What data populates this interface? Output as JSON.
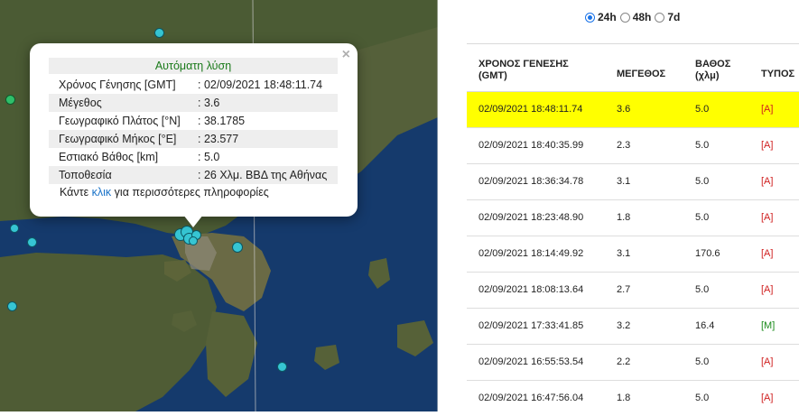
{
  "popup": {
    "title": "Αυτόματη λύση",
    "close_symbol": "×",
    "rows": [
      {
        "label": "Χρόνος Γένησης [GMT]",
        "value": ": 02/09/2021 18:48:11.74"
      },
      {
        "label": "Μέγεθος",
        "value": ": 3.6"
      },
      {
        "label": "Γεωγραφικό Πλάτος [°N]",
        "value": ": 38.1785"
      },
      {
        "label": "Γεωγραφικό Μήκος [°E]",
        "value": ": 23.577"
      },
      {
        "label": "Εστιακό Βάθος [km]",
        "value": ": 5.0"
      },
      {
        "label": "Τοποθεσία",
        "value": ": 26 Χλμ. ΒΒΔ της Αθήνας"
      }
    ],
    "more_prefix": "Κάντε ",
    "more_link": "κλικ",
    "more_suffix": " για περισσότερες πληροφορίες"
  },
  "filter": {
    "options": [
      {
        "label": "24h",
        "selected": true
      },
      {
        "label": "48h",
        "selected": false
      },
      {
        "label": "7d",
        "selected": false
      }
    ]
  },
  "table": {
    "headers": {
      "time_line1": "ΧΡΟΝΟΣ ΓΕΝΕΣΗΣ",
      "time_line2": "(GMT)",
      "magnitude": "ΜΕΓΕΘΟΣ",
      "depth_line1": "ΒΑΘΟΣ",
      "depth_line2": "(χλμ)",
      "type": "ΤΥΠΟΣ"
    },
    "rows": [
      {
        "time": "02/09/2021 18:48:11.74",
        "magnitude": "3.6",
        "depth": "5.0",
        "type": "[A]",
        "highlighted": true
      },
      {
        "time": "02/09/2021 18:40:35.99",
        "magnitude": "2.3",
        "depth": "5.0",
        "type": "[A]"
      },
      {
        "time": "02/09/2021 18:36:34.78",
        "magnitude": "3.1",
        "depth": "5.0",
        "type": "[A]"
      },
      {
        "time": "02/09/2021 18:23:48.90",
        "magnitude": "1.8",
        "depth": "5.0",
        "type": "[A]"
      },
      {
        "time": "02/09/2021 18:14:49.92",
        "magnitude": "3.1",
        "depth": "170.6",
        "type": "[A]"
      },
      {
        "time": "02/09/2021 18:08:13.64",
        "magnitude": "2.7",
        "depth": "5.0",
        "type": "[A]"
      },
      {
        "time": "02/09/2021 17:33:41.85",
        "magnitude": "3.2",
        "depth": "16.4",
        "type": "[M]"
      },
      {
        "time": "02/09/2021 16:55:53.54",
        "magnitude": "2.2",
        "depth": "5.0",
        "type": "[A]"
      },
      {
        "time": "02/09/2021 16:47:56.04",
        "magnitude": "1.8",
        "depth": "5.0",
        "type": "[A]"
      }
    ]
  },
  "colors": {
    "highlight": "#ffff00",
    "type_auto": "#d02020",
    "type_manual": "#1a8a1a",
    "marker": "#36c5d3",
    "popup_title": "#1a7a1a",
    "link": "#1a73c8"
  }
}
